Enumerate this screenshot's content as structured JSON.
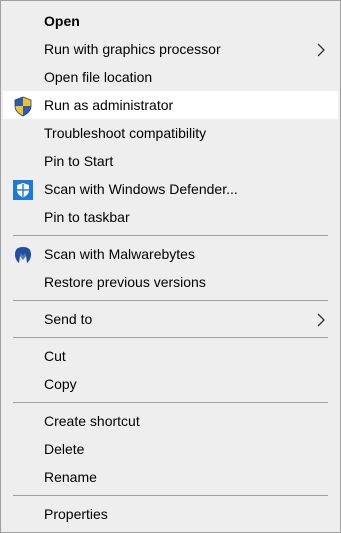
{
  "menu": {
    "items": {
      "open": "Open",
      "run_gpu": "Run with graphics processor",
      "open_location": "Open file location",
      "run_admin": "Run as administrator",
      "troubleshoot": "Troubleshoot compatibility",
      "pin_start": "Pin to Start",
      "scan_defender": "Scan with Windows Defender...",
      "pin_taskbar": "Pin to taskbar",
      "scan_malwarebytes": "Scan with Malwarebytes",
      "restore_versions": "Restore previous versions",
      "send_to": "Send to",
      "cut": "Cut",
      "copy": "Copy",
      "create_shortcut": "Create shortcut",
      "delete": "Delete",
      "rename": "Rename",
      "properties": "Properties"
    },
    "highlighted_item": "Run as administrator",
    "icons": {
      "run_admin": "uac-shield-icon",
      "scan_defender": "windows-defender-icon",
      "scan_malwarebytes": "malwarebytes-icon",
      "submenu": "chevron-right-icon"
    }
  },
  "colors": {
    "menu_bg": "#eeeeee",
    "highlight_bg": "#ffffff",
    "separator": "#a0a0a0",
    "defender_blue": "#1e7ad7",
    "malwarebytes_blue": "#1f4fa0",
    "shield_blue": "#2a5db0",
    "shield_yellow": "#f2c12e"
  }
}
